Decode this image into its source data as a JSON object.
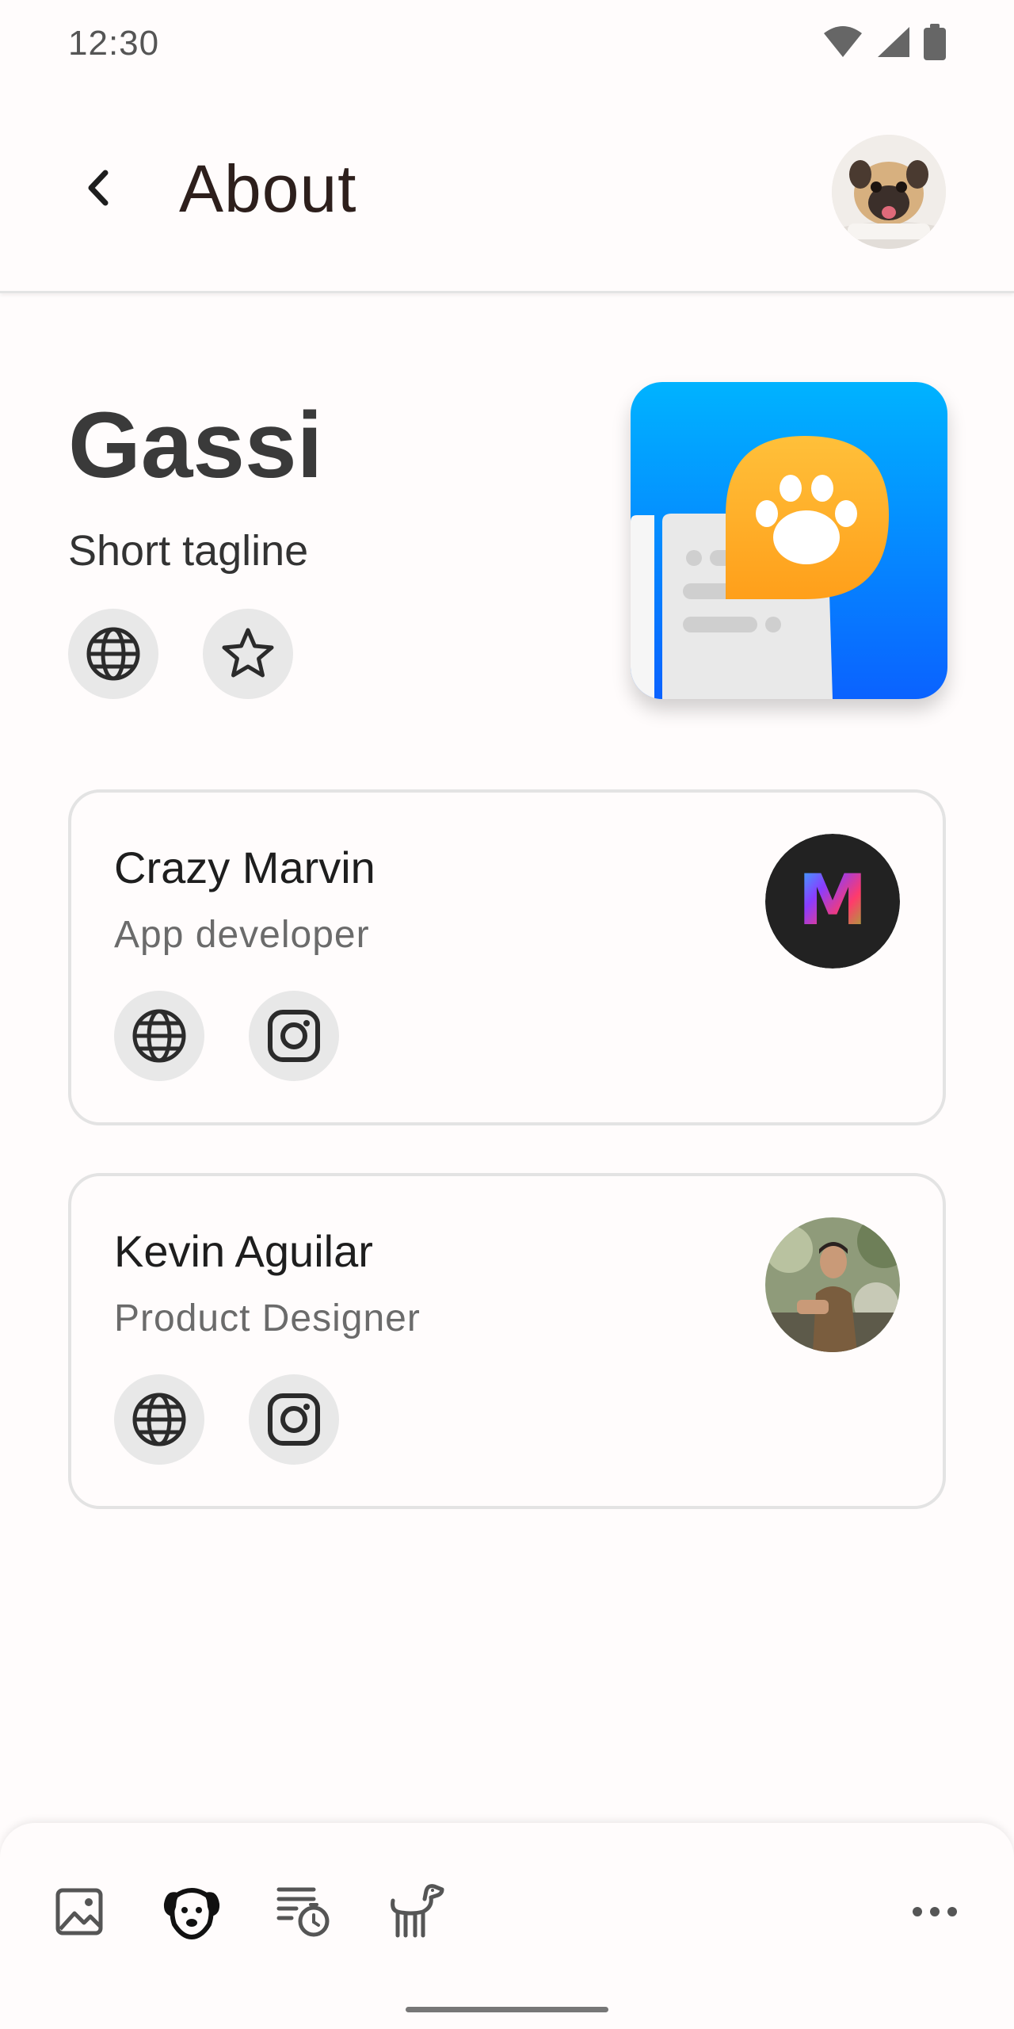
{
  "status_bar": {
    "time": "12:30",
    "icons": [
      "wifi-icon",
      "cellular-signal-icon",
      "battery-icon"
    ]
  },
  "app_bar": {
    "title": "About",
    "back_icon": "back-chevron-icon",
    "avatar": "pug-profile-avatar"
  },
  "app": {
    "name": "Gassi",
    "tagline": "Short tagline",
    "links": [
      "globe-icon",
      "star-icon"
    ],
    "icon": "gassi-app-icon"
  },
  "contributors": [
    {
      "name": "Crazy Marvin",
      "role": "App developer",
      "avatar_letter": "M",
      "links": [
        "globe-icon",
        "instagram-icon"
      ]
    },
    {
      "name": "Kevin Aguilar",
      "role": "Product Designer",
      "avatar": "photo-avatar",
      "links": [
        "globe-icon",
        "instagram-icon"
      ]
    }
  ],
  "bottom_nav": {
    "items": [
      "gallery-icon",
      "dog-face-icon",
      "walk-timer-icon",
      "dog-icon"
    ],
    "active": "dog-face-icon",
    "more": "more-icon"
  },
  "colors": {
    "accent_blue": "#0a74ff",
    "paw_orange": "#ffad25",
    "card_border": "#e3e3e3",
    "icon_button_bg": "#e8e8e8"
  }
}
